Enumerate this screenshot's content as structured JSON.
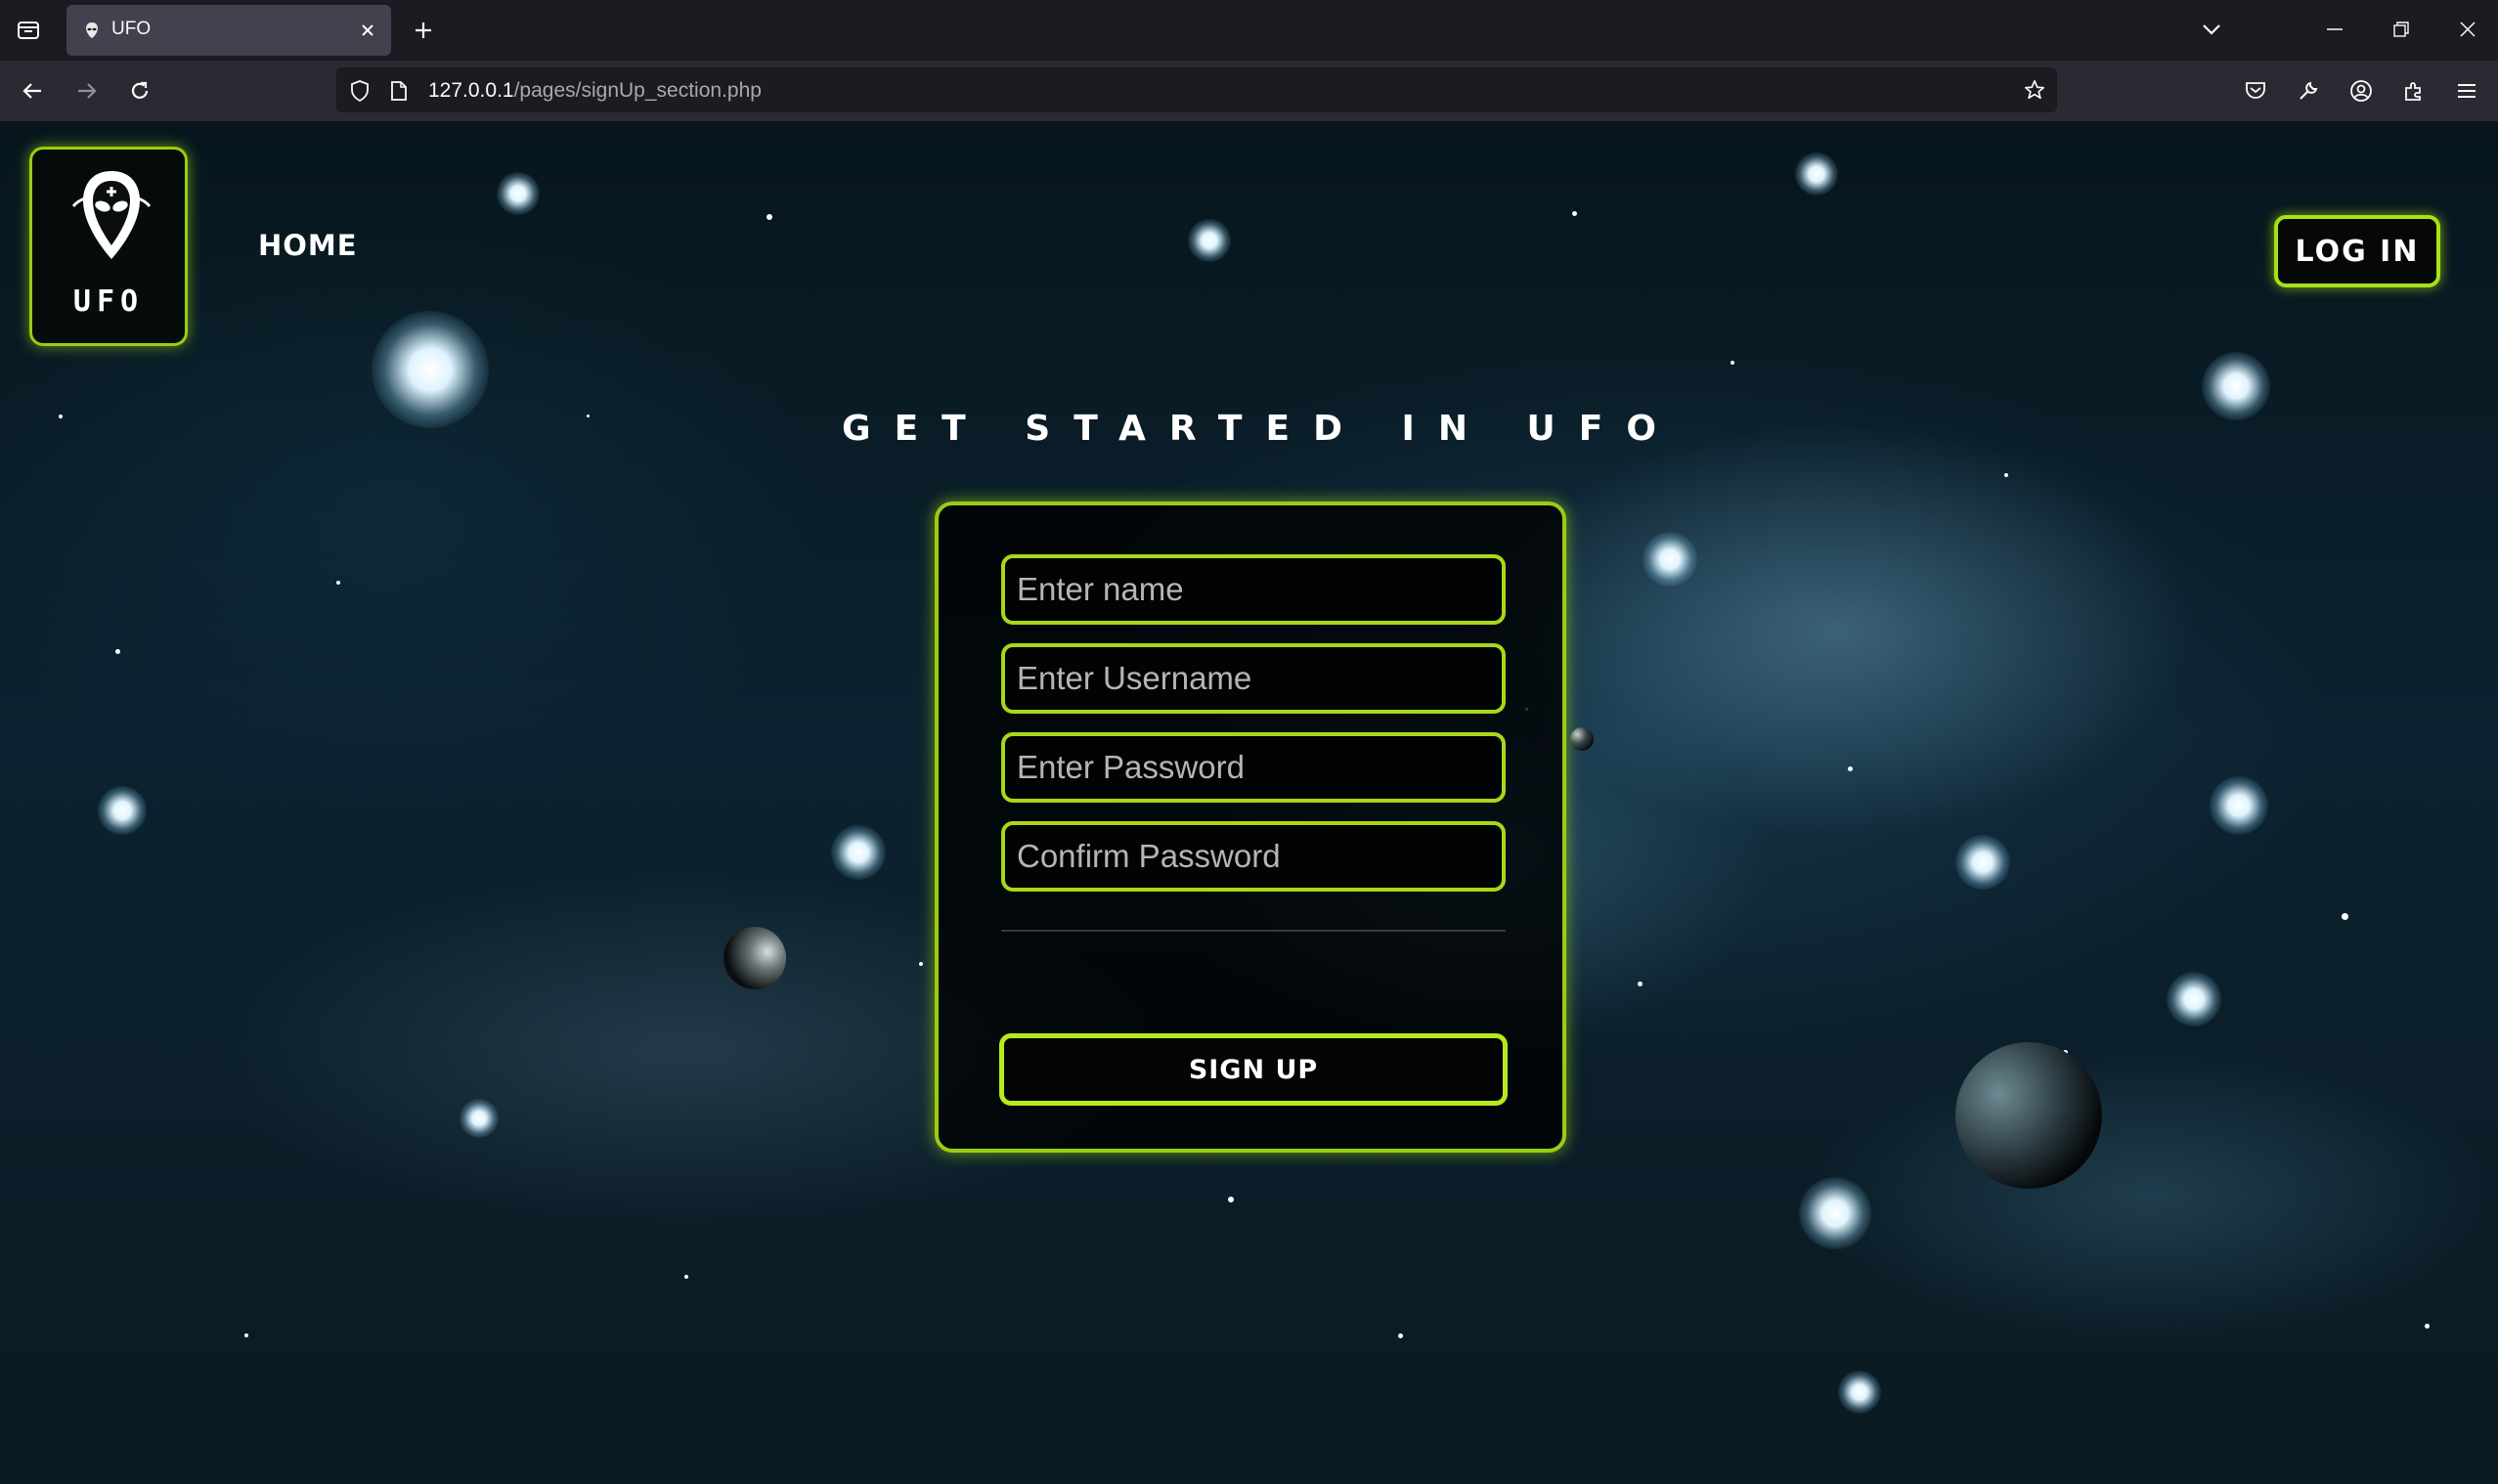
{
  "browser": {
    "tab_title": "UFO",
    "url_host": "127.0.0.1",
    "url_path": "/pages/signUp_section.php",
    "icons": [
      "tab-list-icon",
      "ufo-favicon-icon",
      "close-icon",
      "new-tab-icon",
      "tab-overflow-chevron-icon",
      "minimize-icon",
      "restore-icon",
      "window-close-icon",
      "back-icon",
      "forward-icon",
      "reload-icon",
      "shield-icon",
      "page-icon",
      "bookmark-star-icon",
      "pocket-icon",
      "wrench-icon",
      "account-icon",
      "extensions-icon",
      "menu-icon"
    ]
  },
  "page": {
    "logo_text": "UFO",
    "nav_home": "Home",
    "login_label": "Log in",
    "heading": "Get started in UFO",
    "accent_color": "#9acd12"
  },
  "form": {
    "name_placeholder": "Enter name",
    "username_placeholder": "Enter Username",
    "password_placeholder": "Enter Password",
    "confirm_placeholder": "Confirm Password",
    "submit_label": "Sign up"
  }
}
